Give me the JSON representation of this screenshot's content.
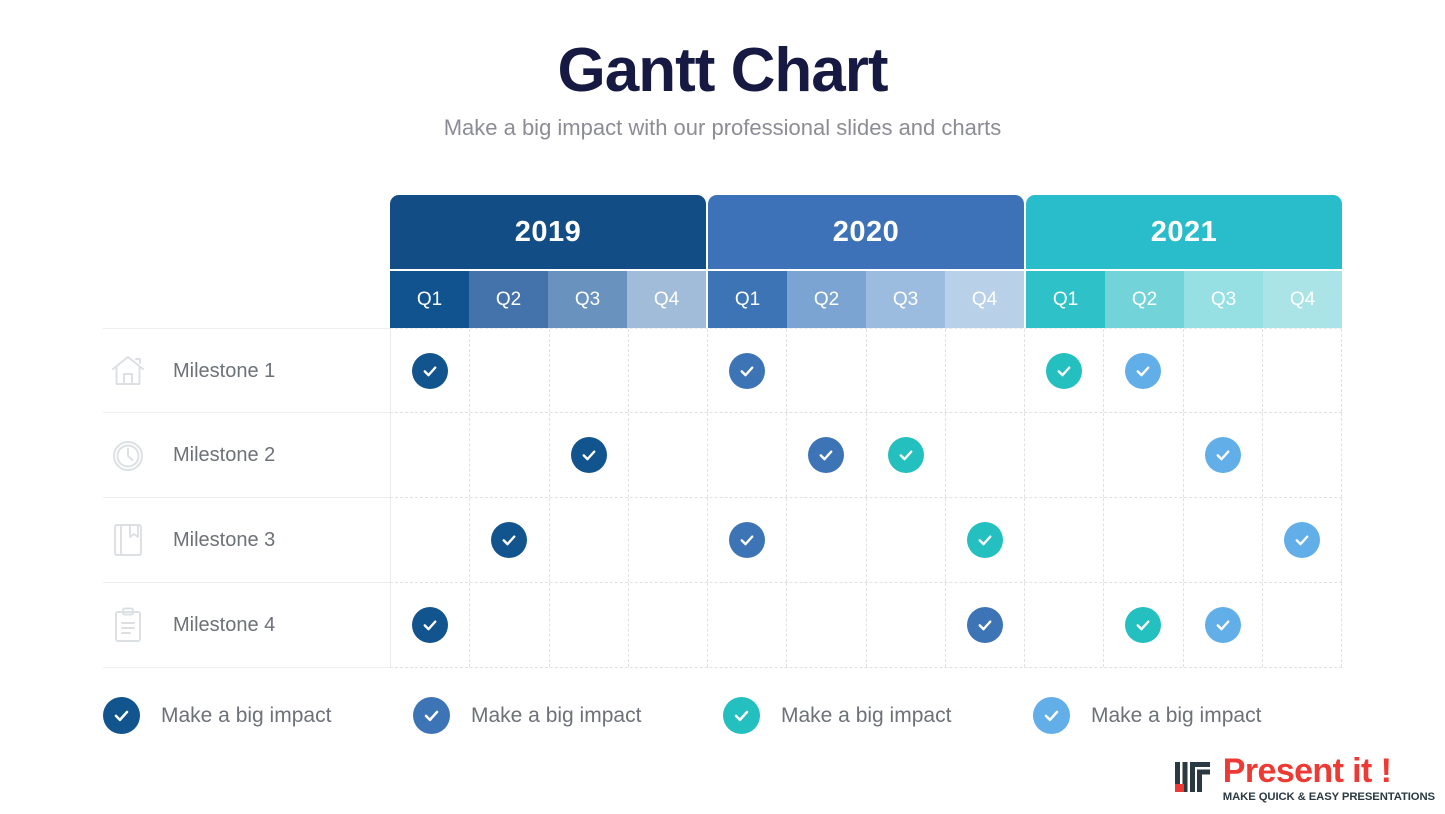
{
  "header": {
    "title": "Gantt Chart",
    "subtitle": "Make a big impact with our professional slides and charts",
    "title_color": "#161a42",
    "subtitle_color": "#8c8c96"
  },
  "chart_data": {
    "type": "table",
    "title": "Gantt Chart",
    "subtitle": "Make a big impact with our professional slides and charts",
    "years": [
      {
        "label": "2019",
        "header_color": "#124d85",
        "quarters": [
          {
            "label": "Q1",
            "color": "#10538f"
          },
          {
            "label": "Q2",
            "color": "#4473ab"
          },
          {
            "label": "Q3",
            "color": "#6a92bf"
          },
          {
            "label": "Q4",
            "color": "#a0bcd8"
          }
        ]
      },
      {
        "label": "2020",
        "header_color": "#3d72b8",
        "quarters": [
          {
            "label": "Q1",
            "color": "#3d74b6"
          },
          {
            "label": "Q2",
            "color": "#7ba4d2"
          },
          {
            "label": "Q3",
            "color": "#9bbcdf"
          },
          {
            "label": "Q4",
            "color": "#b8d0e8"
          }
        ]
      },
      {
        "label": "2021",
        "header_color": "#29bcca",
        "quarters": [
          {
            "label": "Q1",
            "color": "#2fc1c8"
          },
          {
            "label": "Q2",
            "color": "#72d3d8"
          },
          {
            "label": "Q3",
            "color": "#96dfe2"
          },
          {
            "label": "Q4",
            "color": "#abe4e7"
          }
        ]
      }
    ],
    "columns": [
      "2019 Q1",
      "2019 Q2",
      "2019 Q3",
      "2019 Q4",
      "2020 Q1",
      "2020 Q2",
      "2020 Q3",
      "2020 Q4",
      "2021 Q1",
      "2021 Q2",
      "2021 Q3",
      "2021 Q4"
    ],
    "rows": [
      {
        "label": "Milestone 1",
        "icon": "house-icon",
        "marks": [
          {
            "col": 0,
            "color": "#12548d"
          },
          {
            "col": 4,
            "color": "#3d74b6"
          },
          {
            "col": 8,
            "color": "#24bfbf"
          },
          {
            "col": 9,
            "color": "#61aee8"
          }
        ]
      },
      {
        "label": "Milestone 2",
        "icon": "clock-icon",
        "marks": [
          {
            "col": 2,
            "color": "#12548d"
          },
          {
            "col": 5,
            "color": "#3d74b6"
          },
          {
            "col": 6,
            "color": "#24bfbf"
          },
          {
            "col": 10,
            "color": "#61aee8"
          }
        ]
      },
      {
        "label": "Milestone 3",
        "icon": "bookmark-icon",
        "marks": [
          {
            "col": 1,
            "color": "#12548d"
          },
          {
            "col": 4,
            "color": "#3d74b6"
          },
          {
            "col": 7,
            "color": "#24bfbf"
          },
          {
            "col": 11,
            "color": "#61aee8"
          }
        ]
      },
      {
        "label": "Milestone 4",
        "icon": "clipboard-icon",
        "marks": [
          {
            "col": 0,
            "color": "#12548d"
          },
          {
            "col": 7,
            "color": "#3d74b6"
          },
          {
            "col": 9,
            "color": "#24bfbf"
          },
          {
            "col": 10,
            "color": "#61aee8"
          }
        ]
      }
    ]
  },
  "legend": [
    {
      "label": "Make a big impact",
      "color": "#12548d"
    },
    {
      "label": "Make a big impact",
      "color": "#3d74b6"
    },
    {
      "label": "Make a big impact",
      "color": "#24bfbf"
    },
    {
      "label": "Make a big impact",
      "color": "#61aee8"
    }
  ],
  "logo": {
    "name": "Present it !",
    "tagline": "MAKE QUICK & EASY PRESENTATIONS",
    "name_color": "#ee3a34",
    "tagline_color": "#2b3a42"
  }
}
